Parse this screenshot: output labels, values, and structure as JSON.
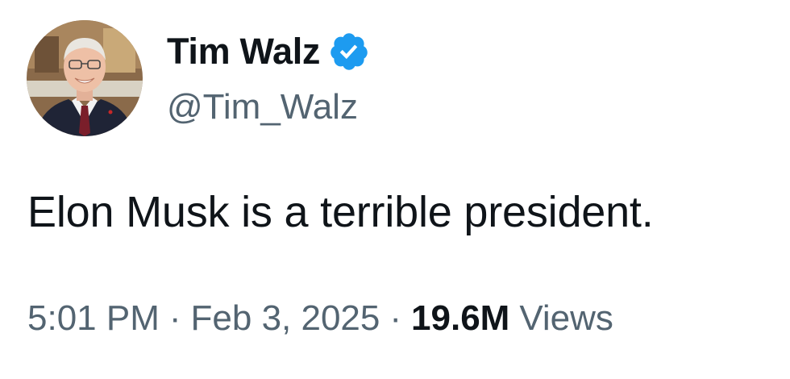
{
  "user": {
    "display_name": "Tim Walz",
    "handle": "@Tim_Walz",
    "verified_icon": "verified-badge-icon",
    "verified_color": "#1d9bf0"
  },
  "tweet": {
    "text": "Elon Musk is a terrible president."
  },
  "meta": {
    "time": "5:01 PM",
    "separator": "·",
    "date": "Feb 3, 2025",
    "views_count": "19.6M",
    "views_label": "Views"
  },
  "colors": {
    "text_primary": "#0f1419",
    "text_secondary": "#536471",
    "background": "#ffffff"
  }
}
